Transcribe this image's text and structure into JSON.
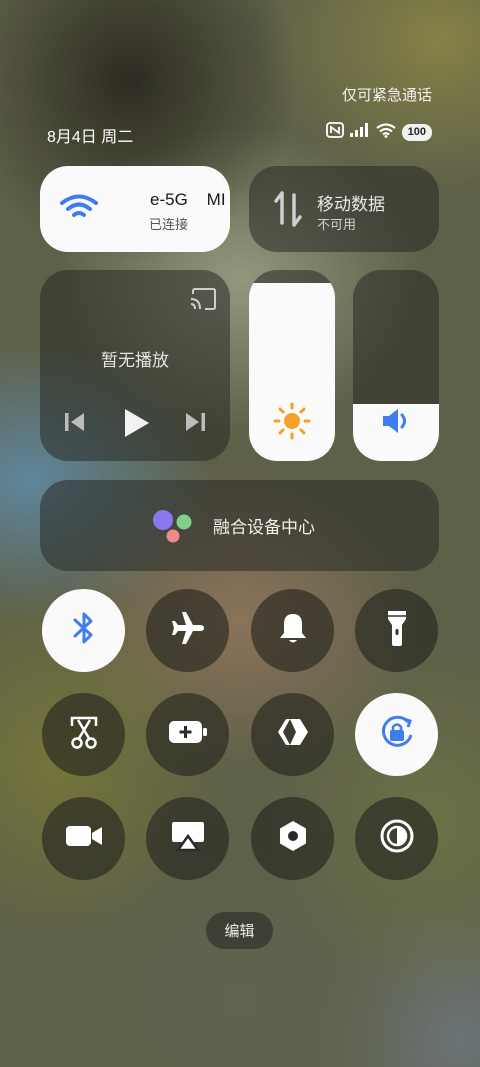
{
  "status_bar": {
    "emergency_text": "仅可紧急通话",
    "datetime": "8月4日 周二",
    "battery": "100",
    "icons": [
      "nfc-icon",
      "signal-icon",
      "wifi-icon",
      "battery-icon"
    ]
  },
  "wifi": {
    "ssid": "e-5G    MI",
    "status": "已连接",
    "icon": "wifi-icon"
  },
  "mobile_data": {
    "title": "移动数据",
    "status": "不可用",
    "icon": "mobile-data-icon"
  },
  "media": {
    "label": "暂无播放"
  },
  "sliders": {
    "brightness_level": 0.93,
    "volume_level": 0.3
  },
  "fusion": {
    "label": "融合设备中心"
  },
  "toggles": [
    {
      "name": "bluetooth",
      "on": true
    },
    {
      "name": "airplane-mode",
      "on": false
    },
    {
      "name": "ringer",
      "on": false
    },
    {
      "name": "flashlight",
      "on": false
    },
    {
      "name": "screenshot",
      "on": false
    },
    {
      "name": "battery-saver",
      "on": false
    },
    {
      "name": "share",
      "on": false
    },
    {
      "name": "rotation-lock",
      "on": true
    },
    {
      "name": "screen-recorder",
      "on": false
    },
    {
      "name": "screen-cast",
      "on": false
    },
    {
      "name": "settings",
      "on": false
    },
    {
      "name": "dark-mode",
      "on": false
    }
  ],
  "edit": {
    "label": "编辑"
  },
  "colors": {
    "accent": "#3f7cf0",
    "sun": "#f4a12a"
  }
}
